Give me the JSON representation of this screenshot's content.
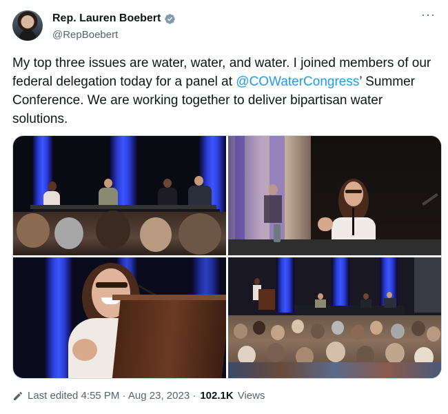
{
  "author": {
    "name": "Rep. Lauren Boebert",
    "handle": "@RepBoebert",
    "verified_icon": "verified-badge-icon",
    "verified_color": "#829aab"
  },
  "menu": {
    "more_icon": "more-icon",
    "label": "···"
  },
  "tweet": {
    "text_before": "My top three issues are water, water, and water. I joined members of our federal delegation today for a panel at ",
    "mention": "@COWaterCongress",
    "text_after": "’ Summer Conference. We are working together to deliver bipartisan water solutions.",
    "mention_color": "#1d9bf0"
  },
  "media": {
    "photo_count": 4,
    "photos": [
      "panel-stage-photo",
      "speaker-closeup-photo",
      "podium-speaker-photo",
      "audience-wide-photo"
    ]
  },
  "footer": {
    "edit_icon": "pencil-icon",
    "edited_label": "Last edited 4:55 PM · Aug 23, 2023 · ",
    "views_count": "102.1K",
    "views_label": "Views"
  }
}
